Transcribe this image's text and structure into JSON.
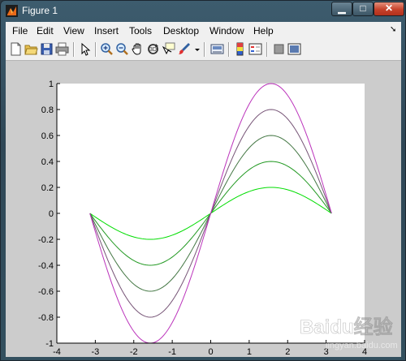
{
  "window": {
    "title": "Figure 1"
  },
  "menu": [
    "File",
    "Edit",
    "View",
    "Insert",
    "Tools",
    "Desktop",
    "Window",
    "Help"
  ],
  "toolbar": {
    "buttons": [
      "new-figure",
      "open-file",
      "save-figure",
      "print-figure",
      "edit-plot",
      "zoom-in",
      "zoom-out",
      "pan",
      "rotate-3d",
      "data-cursor",
      "brush",
      "link-plot",
      "insert-colorbar",
      "insert-legend",
      "hide-plot-tools",
      "show-plot-tools"
    ]
  },
  "chart_data": {
    "type": "line",
    "title": "",
    "xlabel": "",
    "ylabel": "",
    "xlim": [
      -4,
      4
    ],
    "ylim": [
      -1,
      1
    ],
    "xticks": [
      -4,
      -3,
      -2,
      -1,
      0,
      1,
      2,
      3,
      4
    ],
    "yticks": [
      -1,
      -0.8,
      -0.6,
      -0.4,
      -0.2,
      0,
      0.2,
      0.4,
      0.6,
      0.8,
      1
    ],
    "xtick_labels": [
      "-4",
      "-3",
      "-2",
      "-1",
      "0",
      "1",
      "2",
      "3",
      "4"
    ],
    "ytick_labels": [
      "-1",
      "-0.8",
      "-0.6",
      "-0.4",
      "-0.2",
      "0",
      "0.2",
      "0.4",
      "0.6",
      "0.8",
      "1"
    ],
    "grid": false,
    "x_range": [
      -3.14,
      3.14
    ],
    "series": [
      {
        "amplitude": 0.2,
        "color": "#00dd00"
      },
      {
        "amplitude": 0.4,
        "color": "#229922"
      },
      {
        "amplitude": 0.6,
        "color": "#447744"
      },
      {
        "amplitude": 0.8,
        "color": "#775577"
      },
      {
        "amplitude": 1.0,
        "color": "#bb33bb"
      }
    ]
  },
  "watermark": {
    "brand": "Baidu经验",
    "url": "jingyan.baidu.com"
  }
}
